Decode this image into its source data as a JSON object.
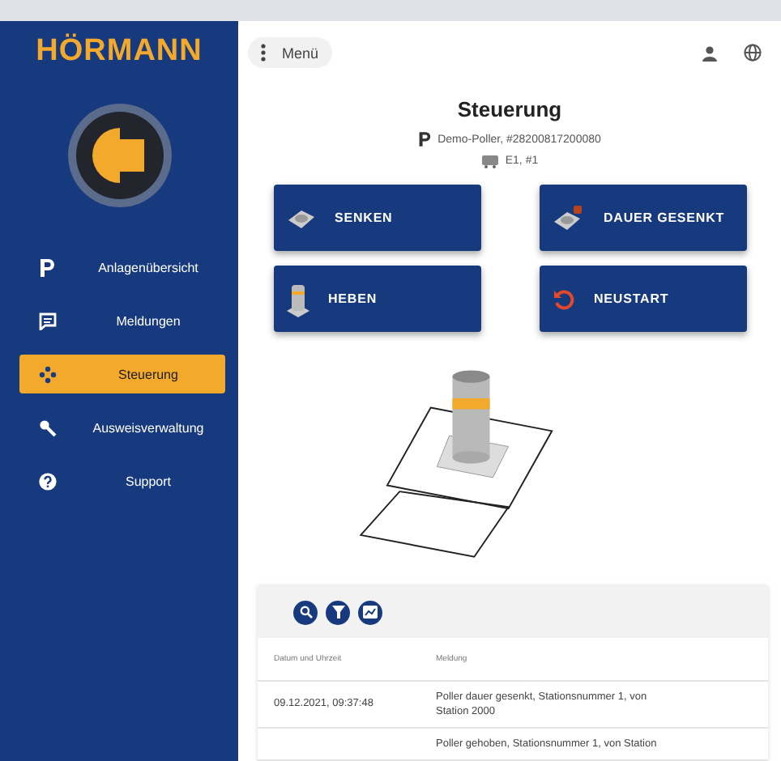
{
  "brand": {
    "name": "HÖRMANN"
  },
  "sidebar": {
    "items": [
      {
        "kind": "p",
        "label": "Anlagenübersicht",
        "selected": false
      },
      {
        "kind": "message",
        "label": "Meldungen",
        "selected": false
      },
      {
        "kind": "move",
        "label": "Steuerung",
        "selected": true
      },
      {
        "kind": "key",
        "label": "Ausweisverwaltung",
        "selected": false
      },
      {
        "kind": "help",
        "label": "Support",
        "selected": false
      }
    ]
  },
  "topbar": {
    "menu_label": "Menü"
  },
  "page": {
    "title": "Steuerung",
    "device": "Demo-Poller, #28200817200080",
    "location": "E1, #1"
  },
  "actions": [
    {
      "kind": "lower",
      "label": "SENKEN"
    },
    {
      "kind": "permanent",
      "label": "DAUER GESENKT"
    },
    {
      "kind": "raise",
      "label": "HEBEN"
    },
    {
      "kind": "restart",
      "label": "NEUSTART"
    }
  ],
  "table": {
    "columns": [
      "Datum und Uhrzeit",
      "Meldung"
    ],
    "rows": [
      {
        "date": "09.12.2021, 09:37:48",
        "message": "Poller dauer gesenkt, Stationsnummer 1, von Station 2000"
      },
      {
        "message": "Poller gehoben, Stationsnummer 1, von Station"
      }
    ]
  }
}
